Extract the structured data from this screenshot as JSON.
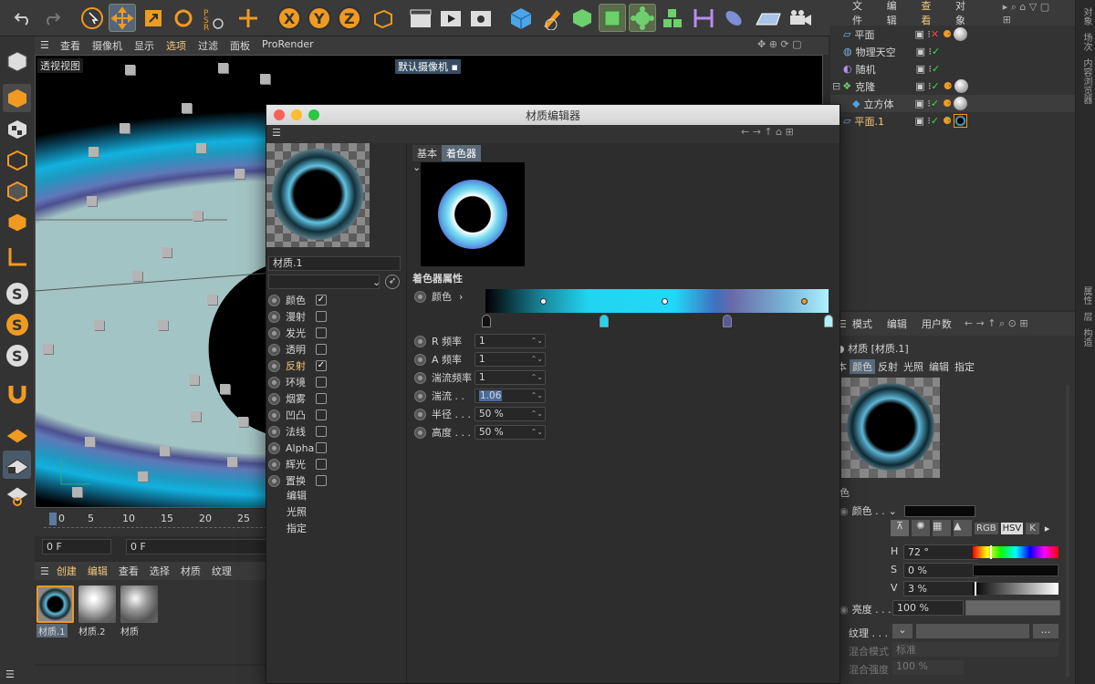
{
  "main_menu": [
    "查看",
    "摄像机",
    "显示",
    "选项",
    "过滤",
    "面板",
    "ProRender"
  ],
  "viewport": {
    "label": "透视视图",
    "camera": "默认摄像机"
  },
  "timeline": {
    "ticks": [
      "0",
      "5",
      "10",
      "15",
      "20",
      "25"
    ],
    "frame_left": "0 F",
    "frame_right": "0 F"
  },
  "material_manager": {
    "menu": [
      "创建",
      "编辑",
      "查看",
      "选择",
      "材质",
      "纹理"
    ],
    "materials": [
      "材质.1",
      "材质.2",
      "材质"
    ]
  },
  "object_manager": {
    "menu": [
      "文件",
      "编辑",
      "查看",
      "对象"
    ],
    "objects": [
      {
        "name": "平面"
      },
      {
        "name": "物理天空"
      },
      {
        "name": "随机"
      },
      {
        "name": "克隆"
      },
      {
        "name": "立方体"
      },
      {
        "name": "平面.1"
      }
    ]
  },
  "side_tabs_top": [
    "对象",
    "场次",
    "内容浏览器"
  ],
  "side_tabs_bottom": [
    "属性",
    "层",
    "构造"
  ],
  "editor": {
    "title": "材质编辑器",
    "material_name": "材质.1",
    "tabs": [
      "基本",
      "着色器"
    ],
    "channels": [
      {
        "name": "颜色",
        "checked": true
      },
      {
        "name": "漫射",
        "checked": false
      },
      {
        "name": "发光",
        "checked": false
      },
      {
        "name": "透明",
        "checked": false
      },
      {
        "name": "反射",
        "checked": true
      },
      {
        "name": "环境",
        "checked": false
      },
      {
        "name": "烟雾",
        "checked": false
      },
      {
        "name": "凹凸",
        "checked": false
      },
      {
        "name": "法线",
        "checked": false
      },
      {
        "name": "Alpha",
        "checked": false
      },
      {
        "name": "辉光",
        "checked": false
      },
      {
        "name": "置换",
        "checked": false
      }
    ],
    "extra": [
      "编辑",
      "光照",
      "指定"
    ],
    "section": "着色器属性",
    "gradient_label": "颜色",
    "params": [
      {
        "label": "R 频率",
        "value": "1"
      },
      {
        "label": "A 频率",
        "value": "1"
      },
      {
        "label": "湍流频率",
        "value": "1"
      },
      {
        "label": "湍流 . .",
        "value": "1.06"
      },
      {
        "label": "半径 . . .",
        "value": "50 %"
      },
      {
        "label": "高度 . . .",
        "value": "50 %"
      }
    ]
  },
  "attributes": {
    "menu": [
      "模式",
      "编辑",
      "用户数"
    ],
    "title": "材质 [材质.1]",
    "tabs": [
      "本",
      "颜色",
      "反射",
      "光照",
      "编辑",
      "指定"
    ],
    "section": "色",
    "color_label": "颜色 . .",
    "modes": [
      "RGB",
      "HSV",
      "K"
    ],
    "h": "72 °",
    "s": "0 %",
    "v": "3 %",
    "brightness_label": "亮度 . . .",
    "brightness": "100 %",
    "texture_label": "纹理 . . .",
    "blend_mode_label": "混合模式",
    "blend_mode": "标准",
    "blend_strength_label": "混合强度",
    "blend_strength": "100 %"
  }
}
